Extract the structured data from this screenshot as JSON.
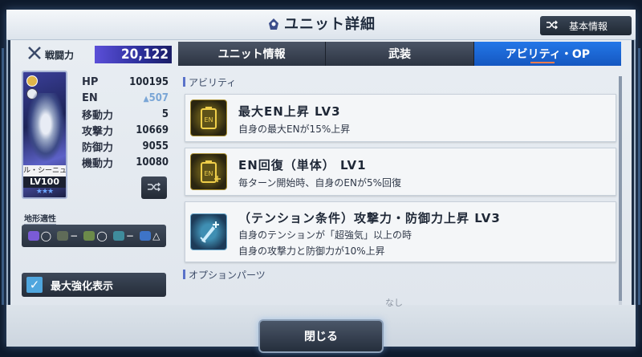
{
  "title": "ユニット詳細",
  "basic_info_label": "基本情報",
  "combat_power": {
    "label": "戦闘力",
    "value": "20,122"
  },
  "unit_card": {
    "name": "ル・シーニュ(E",
    "level": "LV100",
    "stars": "★★★"
  },
  "stats": [
    {
      "label": "HP",
      "value": "100195"
    },
    {
      "label": "EN",
      "value": "507",
      "boosted": true
    },
    {
      "label": "移動力",
      "value": "5"
    },
    {
      "label": "攻撃力",
      "value": "10669"
    },
    {
      "label": "防御力",
      "value": "9055"
    },
    {
      "label": "機動力",
      "value": "10080"
    }
  ],
  "terrain": {
    "label": "地形適性",
    "items": [
      {
        "icon": "space-icon",
        "grade": "◯"
      },
      {
        "icon": "ground-icon",
        "grade": "−"
      },
      {
        "icon": "land-icon",
        "grade": "◯"
      },
      {
        "icon": "water-icon",
        "grade": "−"
      },
      {
        "icon": "city-icon",
        "grade": "△"
      }
    ]
  },
  "max_enhance_label": "最大強化表示",
  "tabs": [
    {
      "label": "ユニット情報",
      "active": false
    },
    {
      "label": "武装",
      "active": false
    },
    {
      "label": "アビリティ・OP",
      "active": true
    }
  ],
  "ability_section": "アビリティ",
  "abilities": [
    {
      "icon": "en-battery-icon",
      "title": "最大EN上昇 LV3",
      "desc": [
        "自身の最大ENが15%上昇"
      ]
    },
    {
      "icon": "en-recover-icon",
      "title": "EN回復（単体） LV1",
      "desc": [
        "毎ターン開始時、自身のENが5%回復"
      ]
    },
    {
      "icon": "sword-up-icon",
      "title": "（テンション条件）攻撃力・防御力上昇 LV3",
      "desc": [
        "自身のテンションが「超強気」以上の時",
        "自身の攻撃力と防御力が10%上昇"
      ]
    }
  ],
  "option_section": "オプションパーツ",
  "option_none": "なし",
  "close_label": "閉じる",
  "colors": {
    "accent_tab": "#1f6ad9",
    "combat_bar": "#3a38b8",
    "checkbox": "#4fa6de"
  }
}
